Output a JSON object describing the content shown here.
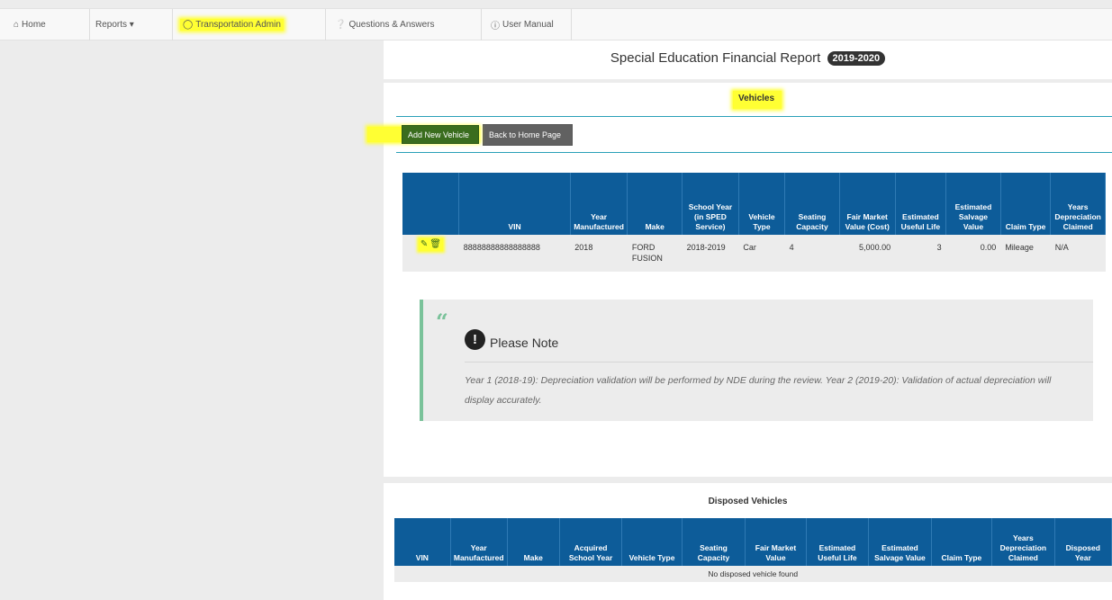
{
  "nav": {
    "home": {
      "label": "Home",
      "icon": "home-icon"
    },
    "reports": {
      "label": "Reports ▾"
    },
    "transport": {
      "label": "Transportation Admin",
      "icon": "bus-icon"
    },
    "qa": {
      "label": "Questions & Answers",
      "icon": "question-circle-icon"
    },
    "manual": {
      "label": "User Manual",
      "icon": "info-circle-icon"
    }
  },
  "header": {
    "title": "Special Education Financial Report",
    "year": "2019-2020"
  },
  "vehicles": {
    "section_title": "Vehicles",
    "add_button": "Add New Vehicle",
    "back_button": "Back to Home Page",
    "columns": [
      "",
      "VIN",
      "Year Manufactured",
      "Make",
      "School Year (in SPED Service)",
      "Vehicle Type",
      "Seating Capacity",
      "Fair Market Value (Cost)",
      "Estimated Useful Life",
      "Estimated Salvage Value",
      "Claim Type",
      "Years Depreciation Claimed"
    ],
    "rows": [
      {
        "vin": "88888888888888888",
        "year": "2018",
        "make": "FORD FUSION",
        "school_year": "2018-2019",
        "type": "Car",
        "seating": "4",
        "fmv": "5,000.00",
        "life": "3",
        "salvage": "0.00",
        "claim": "Mileage",
        "years_claimed": "N/A"
      }
    ]
  },
  "note": {
    "title": "Please Note",
    "body": "Year 1 (2018-19): Depreciation validation will be performed by NDE during the review. Year 2 (2019-20): Validation of actual depreciation will display accurately."
  },
  "disposed": {
    "title": "Disposed Vehicles",
    "columns": [
      "VIN",
      "Year Manufactured",
      "Make",
      "Acquired School Year",
      "Vehicle Type",
      "Seating Capacity",
      "Fair Market Value",
      "Estimated Useful Life",
      "Estimated Salvage Value",
      "Claim Type",
      "Years Depreciation Claimed",
      "Disposed Year"
    ],
    "empty_message": "No disposed vehicle found"
  },
  "colors": {
    "table_header": "#0d5c99",
    "highlight": "#ffff33",
    "accent_teal": "#2aa0b8",
    "note_border": "#7ac29a"
  }
}
